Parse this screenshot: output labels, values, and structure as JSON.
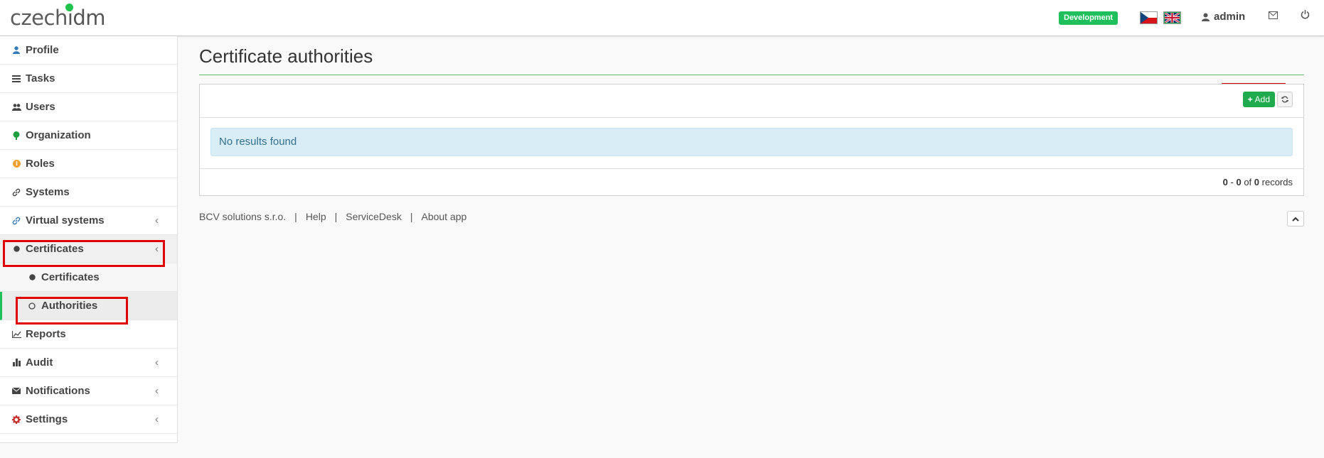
{
  "header": {
    "logo_left": "czech",
    "logo_right": "idm",
    "env_badge": "Development",
    "username": "admin"
  },
  "sidebar": {
    "items": [
      {
        "label": "Profile",
        "icon": "user-icon",
        "color": "#337ab7"
      },
      {
        "label": "Tasks",
        "icon": "tasks-icon",
        "color": "#444"
      },
      {
        "label": "Users",
        "icon": "users-icon",
        "color": "#444"
      },
      {
        "label": "Organization",
        "icon": "tree-icon",
        "color": "#1e9e3e"
      },
      {
        "label": "Roles",
        "icon": "roles-icon",
        "color": "#f0a030"
      },
      {
        "label": "Systems",
        "icon": "link-icon",
        "color": "#444"
      },
      {
        "label": "Virtual systems",
        "icon": "link-icon",
        "color": "#337ab7"
      },
      {
        "label": "Certificates",
        "icon": "circle-icon",
        "color": "#444"
      },
      {
        "label": "Certificates",
        "icon": "circle-icon",
        "color": "#444"
      },
      {
        "label": "Authorities",
        "icon": "circle-outline-icon",
        "color": "#444"
      },
      {
        "label": "Reports",
        "icon": "chart-line-icon",
        "color": "#444"
      },
      {
        "label": "Audit",
        "icon": "bar-chart-icon",
        "color": "#444"
      },
      {
        "label": "Notifications",
        "icon": "envelope-icon",
        "color": "#444"
      },
      {
        "label": "Settings",
        "icon": "gear-icon",
        "color": "#c9302c"
      }
    ]
  },
  "main": {
    "title": "Certificate authorities",
    "add_label": "Add",
    "no_results": "No results found",
    "records": {
      "from": "0",
      "to": "0",
      "total": "0",
      "of": "of",
      "suffix": "records"
    }
  },
  "footer": {
    "links": [
      "BCV solutions s.r.o.",
      "Help",
      "ServiceDesk",
      "About app"
    ]
  },
  "colors": {
    "brand": "#1fbf5c",
    "highlight": "#e00000",
    "info_bg": "#d9edf7"
  }
}
